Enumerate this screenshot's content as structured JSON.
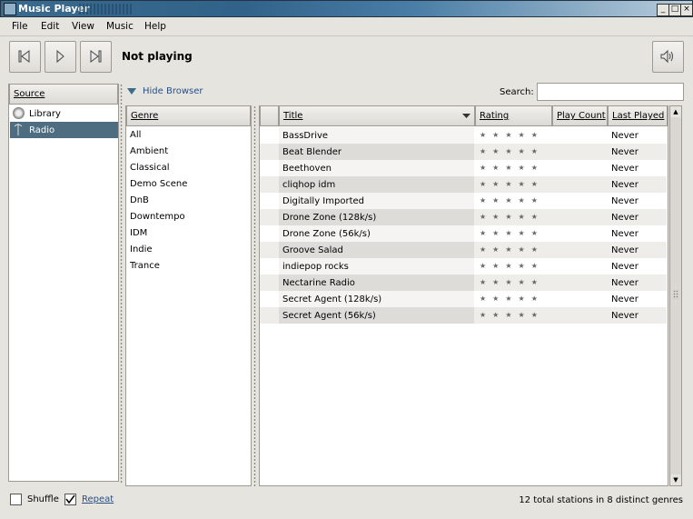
{
  "window": {
    "title": "Music Player",
    "minimize": "_",
    "maximize": "□",
    "close": "×"
  },
  "menu": [
    "File",
    "Edit",
    "View",
    "Music",
    "Help"
  ],
  "toolbar": {
    "status": "Not playing"
  },
  "source": {
    "header": "Source",
    "items": [
      {
        "label": "Library",
        "icon": "library-icon"
      },
      {
        "label": "Radio",
        "icon": "radio-icon"
      }
    ],
    "selected": "Radio"
  },
  "browser": {
    "hide_label": "Hide Browser",
    "search_label": "Search:",
    "search_value": ""
  },
  "genre": {
    "header": "Genre",
    "items": [
      "All",
      "Ambient",
      "Classical",
      "Demo Scene",
      "DnB",
      "Downtempo",
      "IDM",
      "Indie",
      "Trance"
    ]
  },
  "stations": {
    "columns": {
      "title": "Title",
      "rating": "Rating",
      "play_count": "Play Count",
      "last_played": "Last Played"
    },
    "rows": [
      {
        "title": "BassDrive",
        "rating": 0,
        "play_count": "",
        "last_played": "Never"
      },
      {
        "title": "Beat Blender",
        "rating": 0,
        "play_count": "",
        "last_played": "Never"
      },
      {
        "title": "Beethoven",
        "rating": 0,
        "play_count": "",
        "last_played": "Never"
      },
      {
        "title": "cliqhop idm",
        "rating": 0,
        "play_count": "",
        "last_played": "Never"
      },
      {
        "title": "Digitally Imported",
        "rating": 0,
        "play_count": "",
        "last_played": "Never"
      },
      {
        "title": "Drone Zone (128k/s)",
        "rating": 0,
        "play_count": "",
        "last_played": "Never"
      },
      {
        "title": "Drone Zone (56k/s)",
        "rating": 0,
        "play_count": "",
        "last_played": "Never"
      },
      {
        "title": "Groove Salad",
        "rating": 0,
        "play_count": "",
        "last_played": "Never"
      },
      {
        "title": "indiepop rocks",
        "rating": 0,
        "play_count": "",
        "last_played": "Never"
      },
      {
        "title": "Nectarine Radio",
        "rating": 0,
        "play_count": "",
        "last_played": "Never"
      },
      {
        "title": "Secret Agent (128k/s)",
        "rating": 0,
        "play_count": "",
        "last_played": "Never"
      },
      {
        "title": "Secret Agent (56k/s)",
        "rating": 0,
        "play_count": "",
        "last_played": "Never"
      }
    ],
    "star_glyphs": "★★★★★"
  },
  "bottom": {
    "shuffle_label": "Shuffle",
    "shuffle_checked": false,
    "repeat_label": "Repeat",
    "repeat_checked": true,
    "status": "12 total stations in 8 distinct genres"
  },
  "colors": {
    "selection": "#4f6d80",
    "row_alt": "#eeedea",
    "title_sorted": "#dedcd8",
    "link": "#2b4f82"
  }
}
